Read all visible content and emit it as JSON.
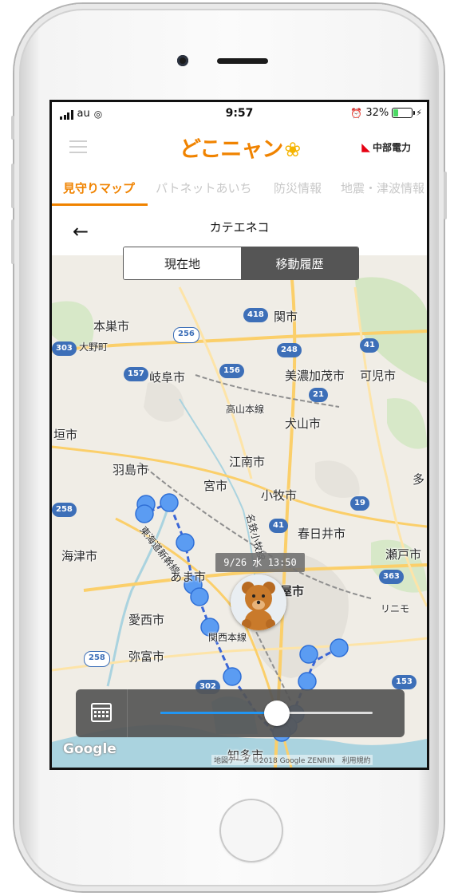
{
  "status_bar": {
    "carrier": "au",
    "time": "9:57",
    "battery_percent": "32%",
    "battery_level": 0.32
  },
  "app": {
    "logo_text": "どこニャン",
    "brand_text": "中部電力"
  },
  "tabs": [
    {
      "label": "見守りマップ",
      "active": true
    },
    {
      "label": "パトネットあいち",
      "active": false
    },
    {
      "label": "防災情報",
      "active": false
    },
    {
      "label": "地震・津波情報",
      "active": false
    }
  ],
  "subheader": {
    "title": "カテエネコ"
  },
  "segmented": {
    "current_label": "現在地",
    "history_label": "移動履歴",
    "selected": "history"
  },
  "map": {
    "tooltip": "9/26 水 13:50",
    "slider_value": 0.55,
    "google_label": "Google",
    "copyright": "地図データ ©2018 Google ZENRIN　利用規約",
    "place_labels": {
      "motosu": "本巣市",
      "oono": "大野町",
      "seki": "関市",
      "gifu": "岐阜市",
      "minokamo": "美濃加茂市",
      "kani": "可児市",
      "takayama_line": "高山本線",
      "inuyama": "犬山市",
      "ogaki": "垣市",
      "hashima": "羽島市",
      "konan": "江南市",
      "ichinomiya": "宮市",
      "komaki": "小牧市",
      "tokaido": "東海道新幹線",
      "meitetsu": "名鉄小牧線",
      "kasugai": "春日井市",
      "seto": "瀬戸市",
      "tsushima": "海津市",
      "ama": "あま市",
      "nagoya": "屋市",
      "aisai": "愛西市",
      "linimo": "リニモ",
      "yatomi": "弥富市",
      "kansai_line": "関西本線",
      "chita": "知多市",
      "taga": "多"
    },
    "route_shields": [
      "418",
      "256",
      "303",
      "248",
      "41",
      "157",
      "156",
      "21",
      "19",
      "41",
      "258",
      "363",
      "302",
      "153",
      "258"
    ]
  }
}
